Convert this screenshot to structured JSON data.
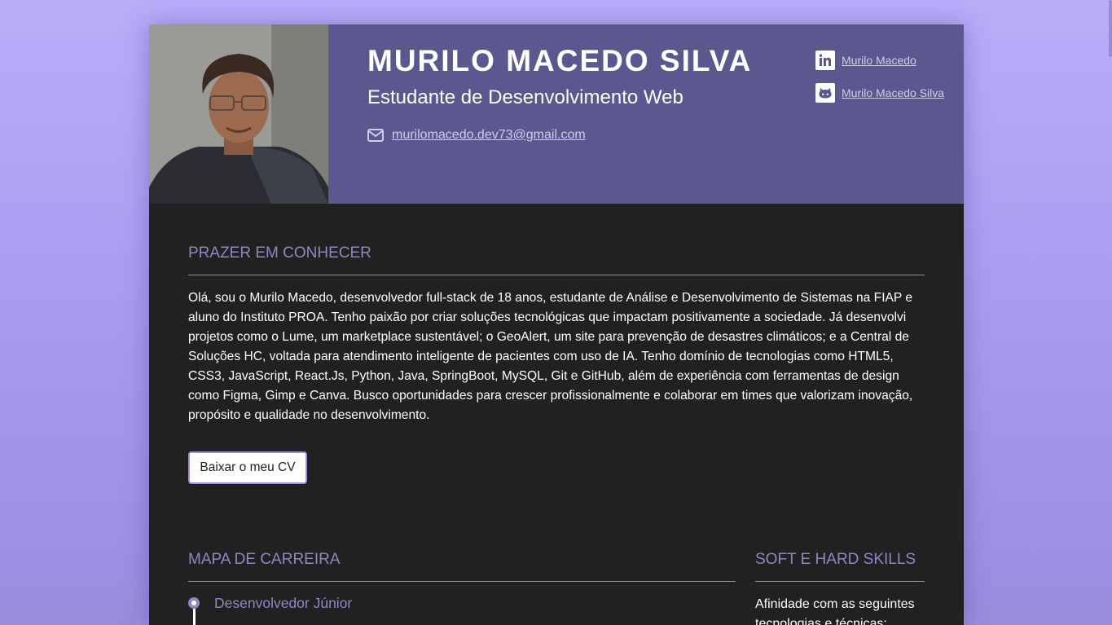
{
  "header": {
    "name": "MURILO MACEDO SILVA",
    "role": "Estudante de Desenvolvimento Web",
    "email": " murilomacedo.dev73@gmail.com",
    "linkedin_label": "Murilo Macedo",
    "github_label": "Murilo Macedo Silva",
    "photo_icon": "profile-photo"
  },
  "about": {
    "title": "PRAZER EM CONHECER",
    "text": "Olá, sou o Murilo Macedo, desenvolvedor full-stack de 18 anos, estudante de Análise e Desenvolvimento de Sistemas na FIAP e aluno do Instituto PROA. Tenho paixão por criar soluções tecnológicas que impactam positivamente a sociedade. Já desenvolvi projetos como o Lume, um marketplace sustentável; o GeoAlert, um site para prevenção de desastres climáticos; e a Central de Soluções HC, voltada para atendimento inteligente de pacientes com uso de IA. Tenho domínio de tecnologias como HTML5, CSS3, JavaScript, React.Js, Python, Java, SpringBoot, MySQL, Git e GitHub, além de experiência com ferramentas de design como Figma, Gimp e Canva. Busco oportunidades para crescer profissionalmente e colaborar em times que valorizam inovação, propósito e qualidade no desenvolvimento.",
    "cv_button": "Baixar o meu CV"
  },
  "career": {
    "title": "MAPA DE CARREIRA",
    "items": [
      {
        "title": "Desenvolvedor Júnior"
      }
    ]
  },
  "skills": {
    "title": "SOFT E HARD SKILLS",
    "intro": "Afinidade com as seguintes tecnologias e técnicas:"
  },
  "colors": {
    "background_gradient": [
      "#b9adf9",
      "#9a8cdd"
    ],
    "header_bg": "#5b578f",
    "content_bg": "#212121",
    "accent": "#8c88c5"
  },
  "icons": [
    "email-icon",
    "linkedin-icon",
    "github-icon",
    "timeline-dot-icon"
  ]
}
